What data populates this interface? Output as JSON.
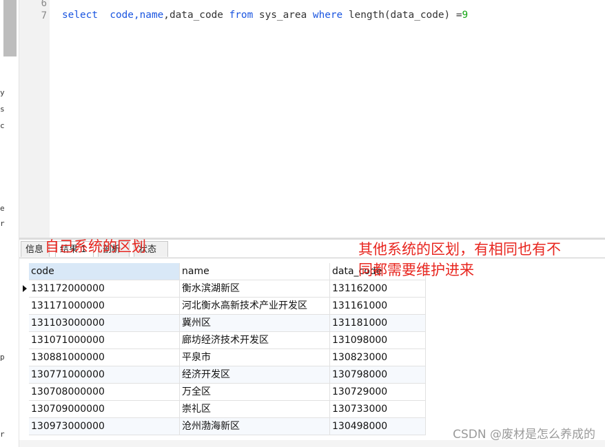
{
  "left_strip": {
    "chars": [
      "y",
      "s",
      "c",
      "e",
      "r",
      "p",
      "r"
    ]
  },
  "editor": {
    "line_numbers": [
      "6",
      "7"
    ],
    "query": {
      "kw_select": "select",
      "cols": "code,",
      "kw_name": "name",
      "rest1": ",data_code ",
      "kw_from": "from",
      "table": " sys_area ",
      "kw_where": "where",
      "cond": " length(data_code) =",
      "val": "9"
    }
  },
  "tabs": [
    {
      "label": "信息"
    },
    {
      "label": "结果 1"
    },
    {
      "label": "剖析"
    },
    {
      "label": "状态"
    }
  ],
  "grid": {
    "columns": [
      "code",
      "name",
      "data_code"
    ],
    "rows": [
      [
        "131172000000",
        "衡水滨湖新区",
        "131162000"
      ],
      [
        "131171000000",
        "河北衡水高新技术产业开发区",
        "131161000"
      ],
      [
        "131103000000",
        "冀州区",
        "131181000"
      ],
      [
        "131071000000",
        "廊坊经济技术开发区",
        "131098000"
      ],
      [
        "130881000000",
        "平泉市",
        "130823000"
      ],
      [
        "130771000000",
        "经济开发区",
        "130798000"
      ],
      [
        "130708000000",
        "万全区",
        "130729000"
      ],
      [
        "130709000000",
        "崇礼区",
        "130733000"
      ],
      [
        "130973000000",
        "沧州渤海新区",
        "130498000"
      ]
    ]
  },
  "annotations": {
    "left": "自己系统的区划",
    "right_line1": "其他系统的区划，有相同也有不",
    "right_line2": "同都需要维护进来"
  },
  "watermark": "CSDN @废材是怎么养成的",
  "colors": {
    "keyword": "#1a55e0",
    "number": "#13a513",
    "annotation": "#e8261f",
    "header_selected": "#d9e8f7"
  }
}
